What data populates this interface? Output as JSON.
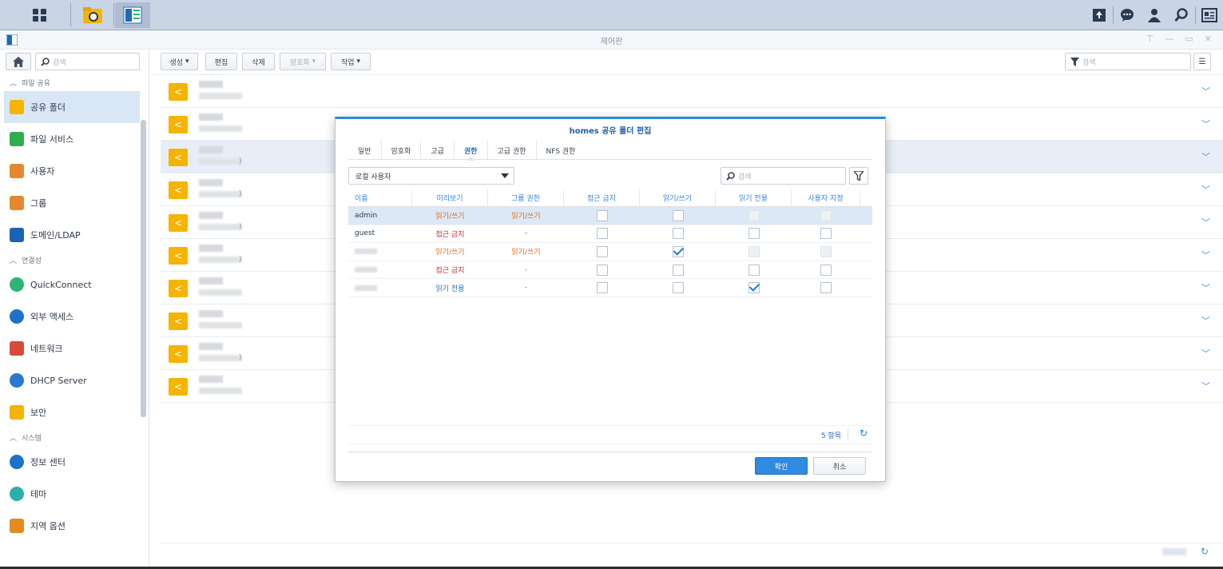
{
  "window": {
    "title": "제어판"
  },
  "taskbar": {
    "right_icons": [
      "upload-icon",
      "chat-icon",
      "user-icon",
      "search-icon",
      "widget-icon"
    ]
  },
  "sidebar": {
    "search_placeholder": "검색",
    "sections": [
      {
        "label": "파일 공유",
        "items": [
          {
            "label": "공유 폴더",
            "icon": "shared-folder-icon",
            "color": "#f4b400",
            "selected": true
          },
          {
            "label": "파일 서비스",
            "icon": "file-services-icon",
            "color": "#2fae4e"
          },
          {
            "label": "사용자",
            "icon": "user-icon",
            "color": "#e48a2c"
          },
          {
            "label": "그룹",
            "icon": "group-icon",
            "color": "#e48a2c"
          },
          {
            "label": "도메인/LDAP",
            "icon": "domain-ldap-icon",
            "color": "#1b62b5"
          }
        ]
      },
      {
        "label": "연결성",
        "items": [
          {
            "label": "QuickConnect",
            "icon": "quickconnect-icon",
            "color": "#2bb673"
          },
          {
            "label": "외부 액세스",
            "icon": "external-access-icon",
            "color": "#1c72c9"
          },
          {
            "label": "네트워크",
            "icon": "network-icon",
            "color": "#d94a3a"
          },
          {
            "label": "DHCP Server",
            "icon": "dhcp-server-icon",
            "color": "#2a78d0"
          },
          {
            "label": "보안",
            "icon": "security-icon",
            "color": "#f4b400"
          }
        ]
      },
      {
        "label": "시스템",
        "items": [
          {
            "label": "정보 센터",
            "icon": "info-center-icon",
            "color": "#1c72c9"
          },
          {
            "label": "테마",
            "icon": "theme-icon",
            "color": "#2bb0a8"
          },
          {
            "label": "지역 옵션",
            "icon": "regional-options-icon",
            "color": "#e58a1f"
          }
        ]
      }
    ]
  },
  "toolbar": {
    "create": "생성",
    "edit": "편집",
    "delete": "삭제",
    "encrypt": "암호화",
    "action": "작업",
    "search_placeholder": "검색"
  },
  "folders": [
    {
      "paren": ""
    },
    {
      "paren": ""
    },
    {
      "paren": ")",
      "highlight": true
    },
    {
      "paren": ")"
    },
    {
      "paren": ")"
    },
    {
      "paren": ")"
    },
    {
      "paren": ""
    },
    {
      "paren": ""
    },
    {
      "paren": ")"
    },
    {
      "paren": ""
    }
  ],
  "dialog": {
    "title": "homes 공유 폴더 편집",
    "tabs": [
      "일반",
      "암호화",
      "고급",
      "권한",
      "고급 권한",
      "NFS 권한"
    ],
    "active_tab": "권한",
    "user_type": "로컬 사용자",
    "search_placeholder": "검색",
    "columns": [
      "이름",
      "미리보기",
      "그룹 권한",
      "접근 금지",
      "읽기/쓰기",
      "읽기 전용",
      "사용자 지정"
    ],
    "rows": [
      {
        "name": "admin",
        "preview": "읽기/쓰기",
        "preview_type": "rw",
        "group": "읽기/쓰기",
        "group_type": "rw",
        "deny": false,
        "rw": false,
        "ro": false,
        "custom": false,
        "disabled": true,
        "selected": true
      },
      {
        "name": "guest",
        "preview": "접근 금지",
        "preview_type": "na",
        "group": "-",
        "group_type": "dash",
        "deny": false,
        "rw": false,
        "ro": false,
        "custom": false,
        "disabled": false
      },
      {
        "name": "",
        "preview": "읽기/쓰기",
        "preview_type": "rw",
        "group": "읽기/쓰기",
        "group_type": "rw",
        "deny": false,
        "rw": true,
        "ro": false,
        "custom": false,
        "disabled": true
      },
      {
        "name": "",
        "preview": "접근 금지",
        "preview_type": "na",
        "group": "-",
        "group_type": "dash",
        "deny": false,
        "rw": false,
        "ro": false,
        "custom": false,
        "disabled": false
      },
      {
        "name": "",
        "preview": "읽기 전용",
        "preview_type": "ro",
        "group": "-",
        "group_type": "dash",
        "deny": false,
        "rw": false,
        "ro": true,
        "custom": false,
        "disabled": false
      }
    ],
    "count": "5 항목",
    "ok": "확인",
    "cancel": "취소"
  }
}
